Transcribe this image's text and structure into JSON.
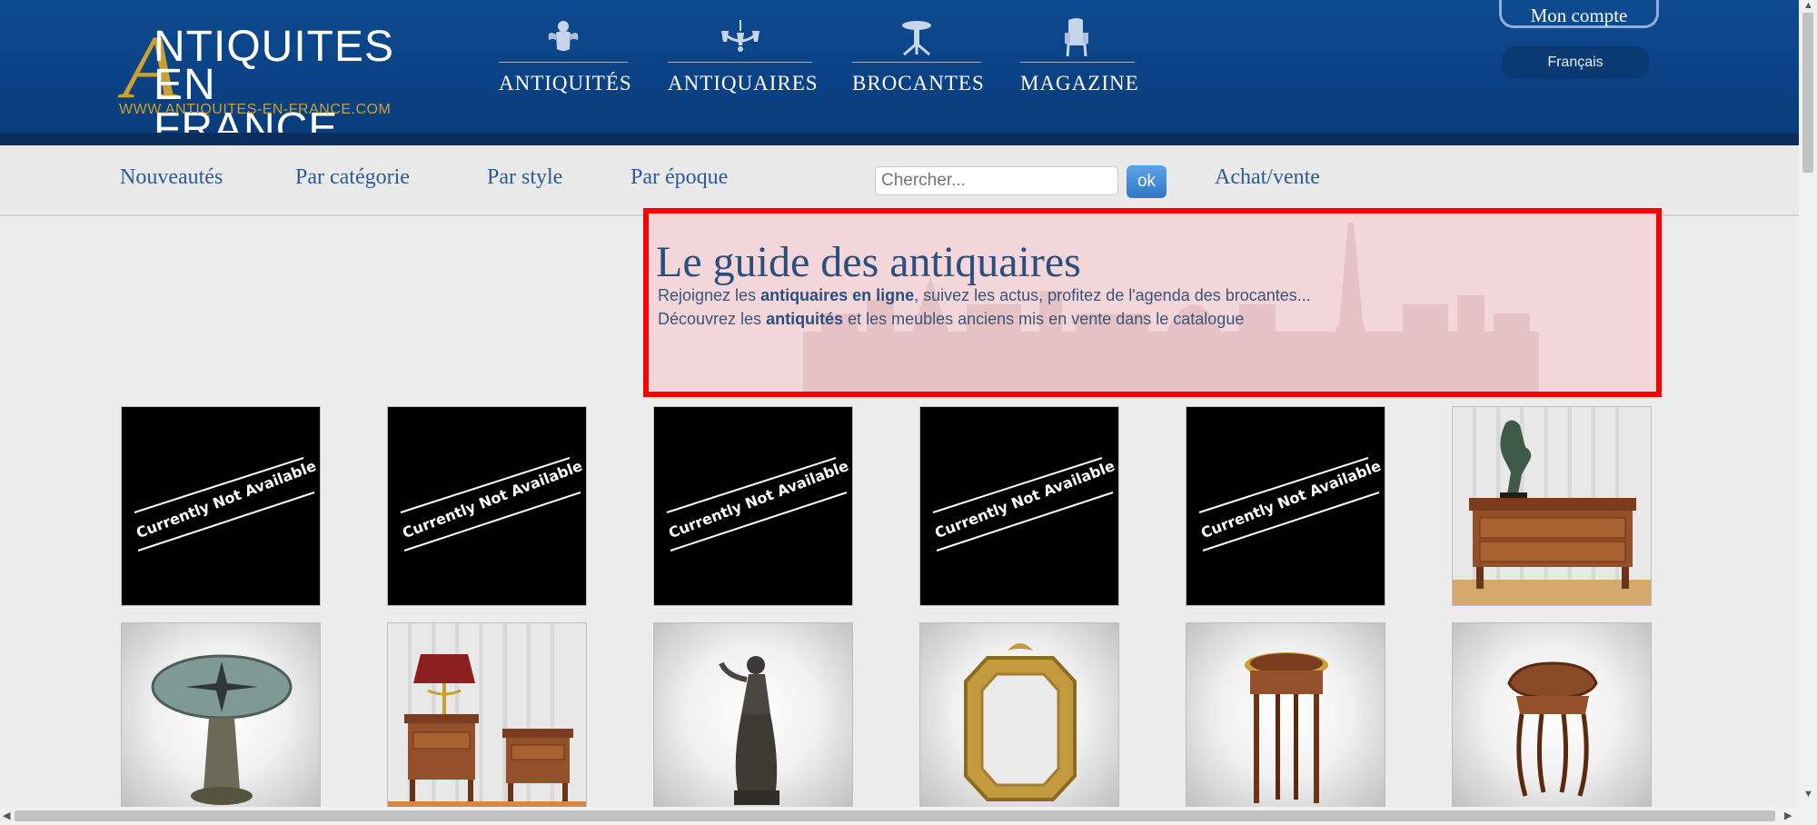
{
  "header": {
    "logo": {
      "line1": "NTIQUITES",
      "line2": "EN FRANCE",
      "big_letter": "A",
      "url": "WWW.ANTIQUITES-EN-FRANCE.COM"
    },
    "nav": [
      {
        "label": "ANTIQUITÉS",
        "icon": "cherub-icon"
      },
      {
        "label": "ANTIQUAIRES",
        "icon": "chandelier-icon"
      },
      {
        "label": "BROCANTES",
        "icon": "pedestal-table-icon"
      },
      {
        "label": "MAGAZINE",
        "icon": "armchair-icon"
      }
    ],
    "account_label": "Mon compte",
    "language_label": "Français"
  },
  "subnav": {
    "links": [
      "Nouveautés",
      "Par catégorie",
      "Par style",
      "Par époque"
    ],
    "search_placeholder": "Chercher...",
    "search_button": "ok",
    "achat_link": "Achat/vente"
  },
  "guide": {
    "title": "Le guide des antiquaires",
    "line1": {
      "pre": "Rejoignez les ",
      "bold": "antiquaires en ligne",
      "post": ", suivez les actus, profitez de l'agenda des brocantes..."
    },
    "line2": {
      "pre": "Découvrez les ",
      "bold": "antiquités",
      "post": " et les meubles anciens mis en vente dans le catalogue"
    }
  },
  "products": {
    "row1": [
      {
        "type": "unavailable",
        "label": "Currently Not Available"
      },
      {
        "type": "unavailable",
        "label": "Currently Not Available"
      },
      {
        "type": "unavailable",
        "label": "Currently Not Available"
      },
      {
        "type": "unavailable",
        "label": "Currently Not Available"
      },
      {
        "type": "unavailable",
        "label": "Currently Not Available"
      },
      {
        "type": "photo",
        "subject": "commode with bronze dancer statue"
      }
    ],
    "row2": [
      {
        "type": "photo",
        "subject": "compass rose pedestal table"
      },
      {
        "type": "photo",
        "subject": "pair of bedside tables with bouillotte lamp"
      },
      {
        "type": "photo",
        "subject": "bronze figure statue"
      },
      {
        "type": "photo",
        "subject": "octagonal gilt mirror"
      },
      {
        "type": "photo",
        "subject": "round side table"
      },
      {
        "type": "photo",
        "subject": "marquetry occasional table"
      }
    ]
  },
  "colors": {
    "header_blue": "#0b4285",
    "gold": "#c9a133",
    "link_blue": "#2b5b9a",
    "highlight_red": "#ff0000"
  }
}
